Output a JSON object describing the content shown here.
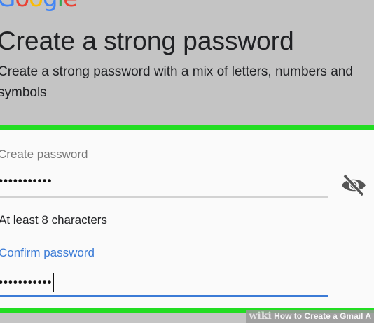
{
  "logo": {
    "letters": [
      {
        "char": "G",
        "color": "#4285F4"
      },
      {
        "char": "o",
        "color": "#EA4335"
      },
      {
        "char": "o",
        "color": "#FBBC05"
      },
      {
        "char": "g",
        "color": "#4285F4"
      },
      {
        "char": "l",
        "color": "#34A853"
      },
      {
        "char": "e",
        "color": "#EA4335"
      }
    ]
  },
  "header": {
    "title": "Create a strong password",
    "subtitle": "Create a strong password with a mix of letters, numbers and symbols"
  },
  "form": {
    "create_label": "Create password",
    "create_value": "•••••••••••",
    "visibility_icon": "eye-off-icon",
    "hint": "At least 8 characters",
    "confirm_label": "Confirm password",
    "confirm_value": "•••••••••••"
  },
  "watermark": {
    "brand": "wiki",
    "text": "How to Create a Gmail A"
  },
  "colors": {
    "highlight": "#22dd22",
    "focus": "#3b7bd6"
  }
}
